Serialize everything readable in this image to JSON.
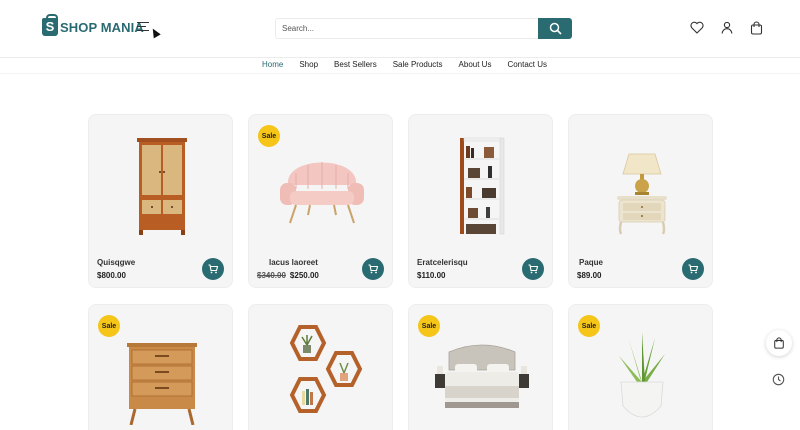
{
  "brand": {
    "logo_letter": "S",
    "name": "SHOP MANIA",
    "color": "#2a6b72"
  },
  "search": {
    "placeholder": "Search..."
  },
  "header_icons": [
    "search-icon",
    "heart-icon",
    "user-icon",
    "cart-icon",
    "menu-icon"
  ],
  "nav": {
    "items": [
      "Home",
      "Shop",
      "Best Sellers",
      "Sale Products",
      "About Us",
      "Contact Us"
    ],
    "active": "Home"
  },
  "sale_label": "Sale",
  "products": [
    {
      "name": "Quisqgwe",
      "old_price": "",
      "price": "$800.00",
      "sale": false,
      "image": "wardrobe"
    },
    {
      "name": "lacus laoreet",
      "old_price": "$340.00",
      "price": "$250.00",
      "sale": true,
      "image": "pink-armchair"
    },
    {
      "name": "Eratcelerisqu",
      "old_price": "",
      "price": "$110.00",
      "sale": false,
      "image": "bookshelf"
    },
    {
      "name": "Paque",
      "old_price": "",
      "price": "$89.00",
      "sale": false,
      "image": "nightstand-lamp"
    },
    {
      "name": "",
      "old_price": "",
      "price": "",
      "sale": true,
      "image": "wooden-dresser"
    },
    {
      "name": "",
      "old_price": "",
      "price": "",
      "sale": false,
      "image": "hexagon-shelves"
    },
    {
      "name": "",
      "old_price": "",
      "price": "",
      "sale": true,
      "image": "upholstered-bed"
    },
    {
      "name": "",
      "old_price": "",
      "price": "",
      "sale": true,
      "image": "potted-plant"
    }
  ],
  "floating": [
    "cart-icon",
    "clock-icon"
  ]
}
